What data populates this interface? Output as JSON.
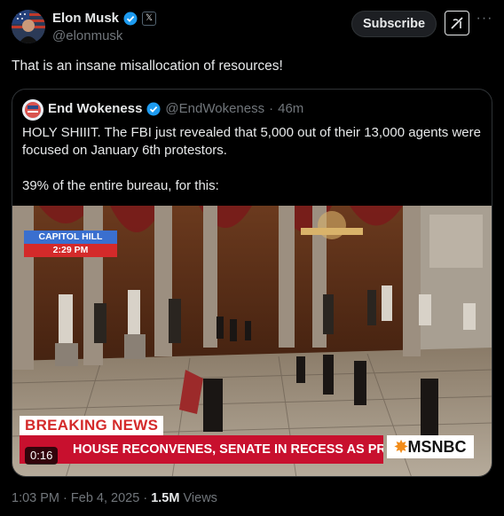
{
  "author": {
    "name": "Elon Musk",
    "handle": "@elonmusk",
    "verified_color": "#1d9bf0",
    "affiliate_badge": "𝕏"
  },
  "actions": {
    "subscribe_label": "Subscribe",
    "grok_icon": "grok-icon",
    "more_icon": "more-icon"
  },
  "tweet": {
    "text": "That is an insane misallocation of resources!"
  },
  "quote": {
    "name": "End Wokeness",
    "handle": "@EndWokeness",
    "sep": "·",
    "age": "46m",
    "paragraphs": [
      "HOLY SHIIIT. The FBI just revealed that 5,000 out of their 13,000 agents were focused on January 6th protestors.",
      "39% of the entire bureau, for this:"
    ],
    "video": {
      "location": "CAPITOL HILL",
      "clock": "2:29 PM",
      "breaking": "BREAKING NEWS",
      "headline": "HOUSE RECONVENES, SENATE IN RECESS AS PROTESTERS MARCH ON CAPITOL",
      "network": "MSNBC",
      "duration": "0:16"
    }
  },
  "meta": {
    "time": "1:03 PM",
    "dot1": "·",
    "date": "Feb 4, 2025",
    "dot2": "·",
    "views_count": "1.5M",
    "views_label": "Views"
  }
}
